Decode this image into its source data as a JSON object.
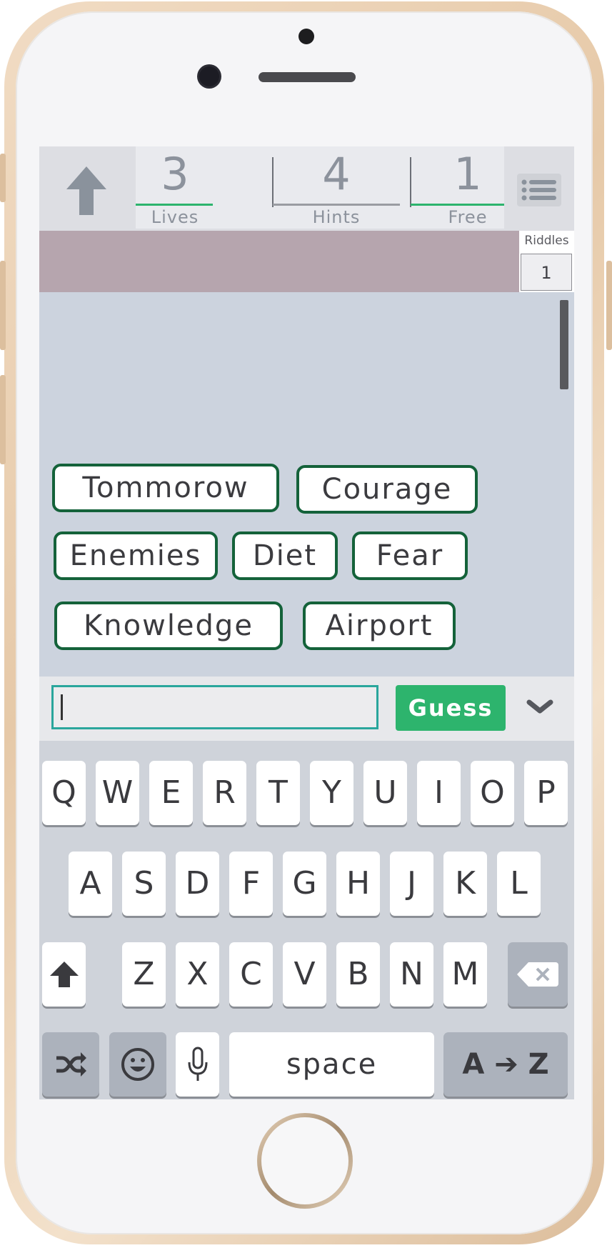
{
  "stats": {
    "lives": {
      "value": "3",
      "label": "Lives"
    },
    "hints": {
      "value": "4",
      "label": "Hints"
    },
    "free": {
      "value": "1",
      "label": "Free"
    }
  },
  "riddles": {
    "label": "Riddles",
    "value": "1"
  },
  "words": [
    "Tommorow",
    "Courage",
    "Enemies",
    "Diet",
    "Fear",
    "Knowledge",
    "Airport"
  ],
  "input": {
    "value": "",
    "placeholder": ""
  },
  "guess_button": "Guess",
  "keyboard": {
    "row1": [
      "Q",
      "W",
      "E",
      "R",
      "T",
      "Y",
      "U",
      "I",
      "O",
      "P"
    ],
    "row2": [
      "A",
      "S",
      "D",
      "F",
      "G",
      "H",
      "J",
      "K",
      "L"
    ],
    "row3": [
      "Z",
      "X",
      "C",
      "V",
      "B",
      "N",
      "M"
    ],
    "space_label": "space",
    "sort_label": "A ➔ Z"
  },
  "icons": [
    "arrow-up-icon",
    "menu-list-icon",
    "chevron-down-icon",
    "shift-icon",
    "backspace-icon",
    "shuffle-icon",
    "emoji-icon",
    "microphone-icon"
  ],
  "colors": {
    "accent_green": "#2db46d",
    "chip_border": "#14623a",
    "stat_underline": "#2db46d",
    "input_border": "#2aa69c",
    "banner": "#b6a5ae",
    "words_bg": "#ccd3de"
  }
}
